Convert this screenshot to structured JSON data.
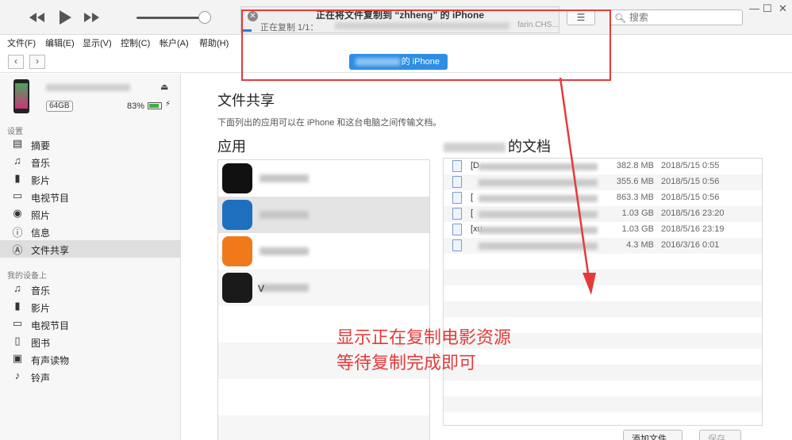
{
  "toolbar": {
    "progress_title": "正在将文件复制到 “zhheng” 的 iPhone",
    "progress_status": "正在复制 1/1：",
    "progress_file_tail": "farin.CHS...",
    "progress_fraction": 0.03,
    "search_placeholder": "搜索",
    "list_view_icon": "list-icon"
  },
  "menubar": [
    "文件(F)",
    "编辑(E)",
    "显示(V)",
    "控制(C)",
    "帐户(A)",
    "帮助(H)"
  ],
  "navbar": {
    "device_pill_label": "的 iPhone"
  },
  "device": {
    "capacity": "64GB",
    "battery_percent": "83%",
    "battery_level": 0.83
  },
  "sidebar": {
    "settings_header": "设置",
    "settings_items": [
      {
        "label": "摘要",
        "icon": "summary-icon"
      },
      {
        "label": "音乐",
        "icon": "music-note-icon"
      },
      {
        "label": "影片",
        "icon": "film-icon"
      },
      {
        "label": "电视节目",
        "icon": "tv-icon"
      },
      {
        "label": "照片",
        "icon": "camera-icon"
      },
      {
        "label": "信息",
        "icon": "info-icon"
      },
      {
        "label": "文件共享",
        "icon": "apps-icon",
        "selected": true
      }
    ],
    "device_header": "我的设备上",
    "device_items": [
      {
        "label": "音乐",
        "icon": "music-note-icon"
      },
      {
        "label": "影片",
        "icon": "film-icon"
      },
      {
        "label": "电视节目",
        "icon": "tv-icon"
      },
      {
        "label": "图书",
        "icon": "book-icon"
      },
      {
        "label": "有声读物",
        "icon": "audiobook-icon"
      },
      {
        "label": "铃声",
        "icon": "bell-icon"
      }
    ]
  },
  "main": {
    "title": "文件共享",
    "description": "下面列出的应用可以在 iPhone 和这台电脑之间传输文档。",
    "apps_header": "应用",
    "docs_header_suffix": "的文档",
    "apps": [
      {
        "name": "",
        "color": "#111111"
      },
      {
        "name": "",
        "color": "#1f6fbf",
        "selected": true
      },
      {
        "name": "",
        "color": "#f07a1a"
      },
      {
        "name": "V",
        "color": "#1a1a1a"
      }
    ],
    "documents": [
      {
        "name": "[D",
        "size": "382.8 MB",
        "date": "2018/5/15 0:55"
      },
      {
        "name": "",
        "size": "355.6 MB",
        "date": "2018/5/15 0:56"
      },
      {
        "name": "[",
        "size": "863.3 MB",
        "date": "2018/5/15 0:56"
      },
      {
        "name": "[",
        "size": "1.03 GB",
        "date": "2018/5/16 23:20"
      },
      {
        "name": "[xu",
        "size": "1.03 GB",
        "date": "2018/5/16 23:19"
      },
      {
        "name": "",
        "size": "4.3 MB",
        "date": "2016/3/16 0:01"
      }
    ],
    "add_file_button": "添加文件...",
    "save_button": "保存..."
  },
  "annotation": {
    "line1": "显示正在复制电影资源",
    "line2": "等待复制完成即可",
    "color": "#e53a3a"
  }
}
